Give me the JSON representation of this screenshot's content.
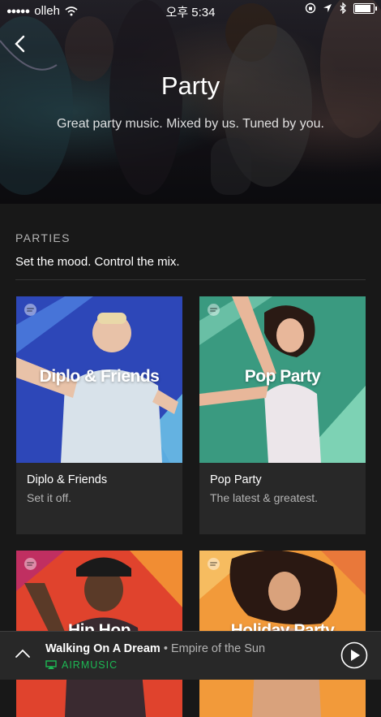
{
  "status_bar": {
    "signal": "●●●●●",
    "carrier": "olleh",
    "time": "오후 5:34"
  },
  "hero": {
    "title": "Party",
    "subtitle": "Great party music. Mixed by us. Tuned by you."
  },
  "section": {
    "label": "PARTIES",
    "description": "Set the mood. Control the mix."
  },
  "cards": [
    {
      "overlay": "Diplo & Friends",
      "title": "Diplo & Friends",
      "description": "Set it off.",
      "color": "#2d47b8"
    },
    {
      "overlay": "Pop Party",
      "title": "Pop Party",
      "description": "The latest & greatest.",
      "color": "#3a9a80"
    },
    {
      "overlay": "Hip Hop",
      "color": "#e0432d"
    },
    {
      "overlay": "Holiday Party",
      "color": "#f29a3a"
    }
  ],
  "player": {
    "track": "Walking On A Dream",
    "separator": " • ",
    "artist": "Empire of the Sun",
    "device": "AIRMUSIC"
  },
  "colors": {
    "background": "#181818",
    "card": "#282828",
    "accent": "#1db954"
  }
}
